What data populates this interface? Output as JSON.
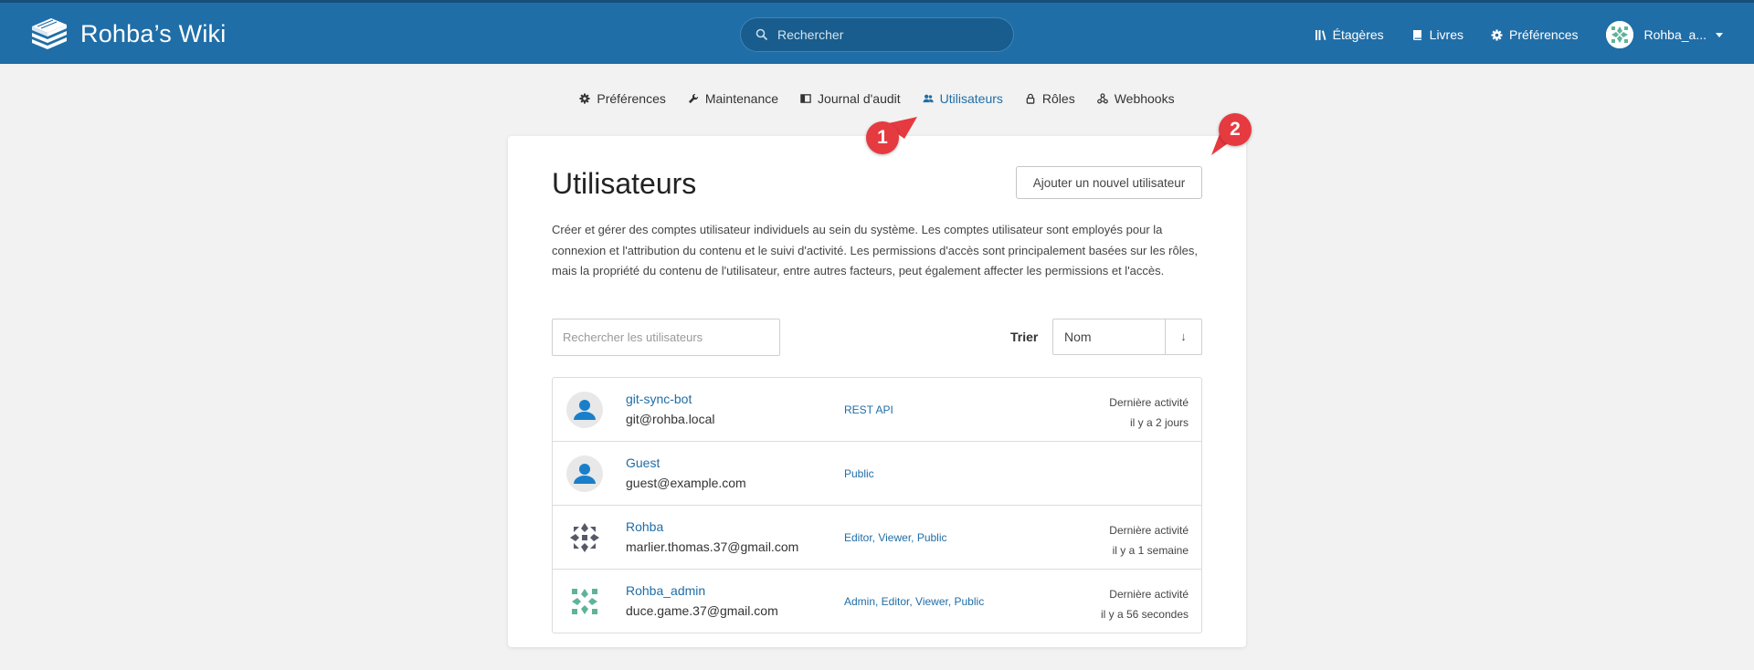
{
  "header": {
    "app_name": "Rohba’s Wiki",
    "search_placeholder": "Rechercher",
    "links": [
      {
        "label": "Étagères",
        "icon": "shelves-icon"
      },
      {
        "label": "Livres",
        "icon": "book-icon"
      },
      {
        "label": "Préférences",
        "icon": "gear-icon"
      }
    ],
    "user_name": "Rohba_a...",
    "accent": "#206ea7"
  },
  "settings_nav": [
    {
      "label": "Préférences",
      "icon": "gear-icon",
      "active": false
    },
    {
      "label": "Maintenance",
      "icon": "wrench-icon",
      "active": false
    },
    {
      "label": "Journal d'audit",
      "icon": "audit-log-icon",
      "active": false
    },
    {
      "label": "Utilisateurs",
      "icon": "users-icon",
      "active": true
    },
    {
      "label": "Rôles",
      "icon": "lock-icon",
      "active": false
    },
    {
      "label": "Webhooks",
      "icon": "webhook-icon",
      "active": false
    }
  ],
  "page": {
    "title": "Utilisateurs",
    "add_button": "Ajouter un nouvel utilisateur",
    "description": "Créer et gérer des comptes utilisateur individuels au sein du système. Les comptes utilisateur sont employés pour la connexion et l'attribution du contenu et le suivi d'activité. Les permissions d'accès sont principalement basées sur les rôles, mais la propriété du contenu de l'utilisateur, entre autres facteurs, peut également affecter les permissions et l'accès.",
    "search_placeholder": "Rechercher les utilisateurs",
    "sort_label": "Trier",
    "sort_value": "Nom",
    "sort_direction": "↓"
  },
  "users": [
    {
      "name": "git-sync-bot",
      "email": "git@rohba.local",
      "roles": "REST API",
      "activity_label": "Dernière activité",
      "activity_time": "il y a 2 jours",
      "avatar": "default-user"
    },
    {
      "name": "Guest",
      "email": "guest@example.com",
      "roles": "Public",
      "activity_label": "",
      "activity_time": "",
      "avatar": "default-user"
    },
    {
      "name": "Rohba",
      "email": "marlier.thomas.37@gmail.com",
      "roles": "Editor, Viewer, Public",
      "activity_label": "Dernière activité",
      "activity_time": "il y a 1 semaine",
      "avatar": "pattern-grey"
    },
    {
      "name": "Rohba_admin",
      "email": "duce.game.37@gmail.com",
      "roles": "Admin, Editor, Viewer, Public",
      "activity_label": "Dernière activité",
      "activity_time": "il y a 56 secondes",
      "avatar": "pattern-green"
    }
  ],
  "annotations": [
    {
      "number": "1",
      "color": "#e53a40"
    },
    {
      "number": "2",
      "color": "#e53a40"
    }
  ]
}
